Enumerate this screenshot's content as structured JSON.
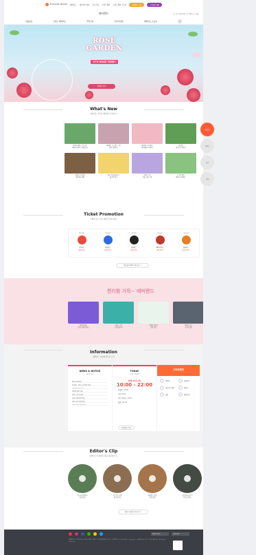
{
  "topbar": {
    "logo": "EVERLAND RESORT",
    "links": [
      "에버랜드",
      "캐리비안 베이",
      "홈브리지",
      "스피드웨이",
      "스피드웨이 스토어"
    ],
    "pill1": "에버랜드 쇼핑",
    "pill2": "고객상담 채팅"
  },
  "brand": {
    "name": "에버랜드",
    "util": "로그인 | 회원가입 | 고객센터 | 다국어"
  },
  "gnb": [
    "이용정보",
    "스마트 에버랜드",
    "즐길거리",
    "할인/이벤트",
    "에버랜드 스토리"
  ],
  "hero": {
    "title1": "ROSE",
    "title2": "GARDEN",
    "tag": "IT'S ROSE TIME!",
    "cta": "자세히 보기"
  },
  "whatsnew": {
    "title": "What's New",
    "sub": "쉴새 없는 즐거움 에버랜드의 새소식",
    "cards": [
      {
        "cap": "장미의 계절, 로즈가든\n5월의 축제가 시작됩니다",
        "color": "#6aa86a"
      },
      {
        "cap": "에버랜드 포시즌스 가든\n장미 테마파크",
        "color": "#c9a2b0"
      },
      {
        "cap": "에버랜드 판다월드\n바오패밀리 이야기",
        "color": "#f0b9c4"
      },
      {
        "cap": "판다월드\n바오가족 이야기",
        "color": "#5f9e54"
      },
      {
        "cap": "가정의 달 이벤트\n어린이날 혜택",
        "color": "#7d6043"
      },
      {
        "cap": "봄꽃 축제 튤립가든\n플라워 위크",
        "color": "#f3d36b"
      },
      {
        "cap": "라벤더 가든\n퍼플 선셋 스팟",
        "color": "#b9a6e0"
      },
      {
        "cap": "뉴 어트랙션\n캐릭터 퍼레이드",
        "color": "#8ac27f"
      }
    ],
    "side": [
      {
        "label": "새소식",
        "active": true
      },
      {
        "label": "이벤트",
        "active": false
      },
      {
        "label": "공연",
        "active": false
      },
      {
        "label": "축제",
        "active": false
      }
    ]
  },
  "promo": {
    "title": "Ticket Promotion",
    "sub": "나에게 맞는 할인 혜택을 찾아보세요",
    "items": [
      {
        "lbl": "제휴할인",
        "nm": "신한카드",
        "pr": "최대 40%",
        "color": "#e74c3c"
      },
      {
        "lbl": "제휴할인",
        "nm": "삼성카드",
        "pr": "최대 35%",
        "color": "#2d6cdf"
      },
      {
        "lbl": "제휴할인",
        "nm": "현대카드",
        "pr": "최대 30%",
        "color": "#222222"
      },
      {
        "lbl": "제휴할인",
        "nm": "KB국민카드",
        "pr": "최대 30%",
        "color": "#c0392b"
      },
      {
        "lbl": "제휴할인",
        "nm": "롯데카드",
        "pr": "최대 25%",
        "color": "#e67e22"
      }
    ],
    "more": "제휴할인 혜택 모두보기  >"
  },
  "events": {
    "title": "편리함 가득~ 애버랜드",
    "cards": [
      {
        "cap": "내게 딱 맞는\n스마트 예약 서비스",
        "color": "#7b5cd6"
      },
      {
        "cap": "그랜드 오픈\n스마트줄서기",
        "color": "#3bb0a9"
      },
      {
        "cap": "모바일 이용권\n간편 입장",
        "color": "#e9f4ed"
      },
      {
        "cap": "캐릭터 굿즈\n스토어 할인",
        "color": "#5a6470"
      }
    ]
  },
  "info": {
    "title": "Information",
    "sub": "에버랜드 이용에 필요한 소식",
    "notice": {
      "title": "NEWS & NOTICE",
      "sub": "새로운 소식",
      "items": [
        "장미 축제 안내",
        "판다월드 관람 시간 변경 안내",
        "어트랙션 운휴 안내",
        "주차장 이용 안내",
        "우천 시 운영 안내",
        "티켓 구매 방법 안내",
        "이용 시간 변경 안내",
        "분실물 센터 운영 안내"
      ]
    },
    "today": {
      "title": "TODAY",
      "sub": "오늘의 운영정보",
      "date": "05월 15일 (목)",
      "hours": "10:00 - 22:00",
      "rows": [
        "퍼레이드 13:00",
        "공연 15:00",
        "야간 퍼레이드 20:00",
        "불꽃쇼 21:30"
      ],
      "btn": "운영정보 보기"
    },
    "smart": {
      "title": "스마트예약",
      "items": [
        "이용권",
        "즐길거리",
        "대기시간 확인",
        "길찾기",
        "맛집",
        "편의시설"
      ]
    }
  },
  "clip": {
    "title": "Editor's Clip",
    "sub": "에버랜드의 생생한 이야기를 영상으로",
    "items": [
      {
        "cap": "판다 바오패밀리\n일상 클립",
        "color": "#5b7d55"
      },
      {
        "cap": "로즈가든 산책\n플라워 투어",
        "color": "#8b6e52"
      },
      {
        "cap": "에버랜드 맛집\n먹방 클립",
        "color": "#a5744a"
      },
      {
        "cap": "어트랙션 탑승기\nT익스프레스",
        "color": "#444a44"
      }
    ],
    "more": "에디터 클립 모두보기  >"
  },
  "footer": {
    "fam1": "패밀리사이트",
    "fam2": "관련사이트",
    "text": "삼성물산(주) 리조트부문 | 경기도 용인시 처인구 포곡읍 에버랜드로 199 | 고객센터 031-320-5000 | Copyright © SAMSUNG C&T CORPORATION. All Rights Reserved."
  },
  "colors": {
    "accent": "#e74c3c",
    "smart": "#ff6b35",
    "footer": "#3b3e44",
    "event_bg": "#f9e1e6"
  }
}
